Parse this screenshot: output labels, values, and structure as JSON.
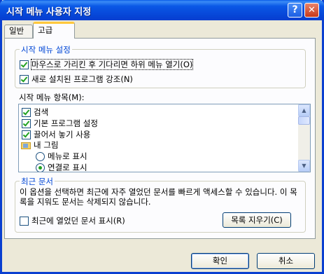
{
  "window": {
    "title": "시작 메뉴 사용자 지정"
  },
  "titlebar": {
    "help_glyph": "?",
    "close_glyph": "✕"
  },
  "tabs": [
    {
      "label": "일반"
    },
    {
      "label": "고급"
    }
  ],
  "start_menu_settings": {
    "title": "시작 메뉴 설정",
    "options": [
      {
        "label": "마우스로 가리킨 후 기다리면 하위 메뉴 열기(O)",
        "checked": true
      },
      {
        "label": "새로 설치된 프로그램 강조(N)",
        "checked": true
      }
    ]
  },
  "start_menu_items": {
    "label": "시작 메뉴 항목(M):",
    "items": [
      {
        "label": "검색",
        "type": "checkbox",
        "checked": true
      },
      {
        "label": "기본 프로그램 설정",
        "type": "checkbox",
        "checked": true
      },
      {
        "label": "끌어서 놓기 사용",
        "type": "checkbox",
        "checked": true
      },
      {
        "label": "내 그림",
        "type": "folder"
      },
      {
        "label": "메뉴로 표시",
        "type": "radio",
        "checked": false
      },
      {
        "label": "연결로 표시",
        "type": "radio",
        "checked": true
      }
    ]
  },
  "recent_documents": {
    "title": "최근 문서",
    "description": "이 옵션을 선택하면 최근에 자주 열었던 문서를 빠르게 액세스할 수 있습니다. 이 목록을 지워도 문서는 삭제되지 않습니다.",
    "show_label": "최근에 열었던 문서 표시(R)",
    "show_checked": false,
    "clear_button": "목록 지우기(C)"
  },
  "buttons": {
    "ok": "확인",
    "cancel": "취소"
  }
}
